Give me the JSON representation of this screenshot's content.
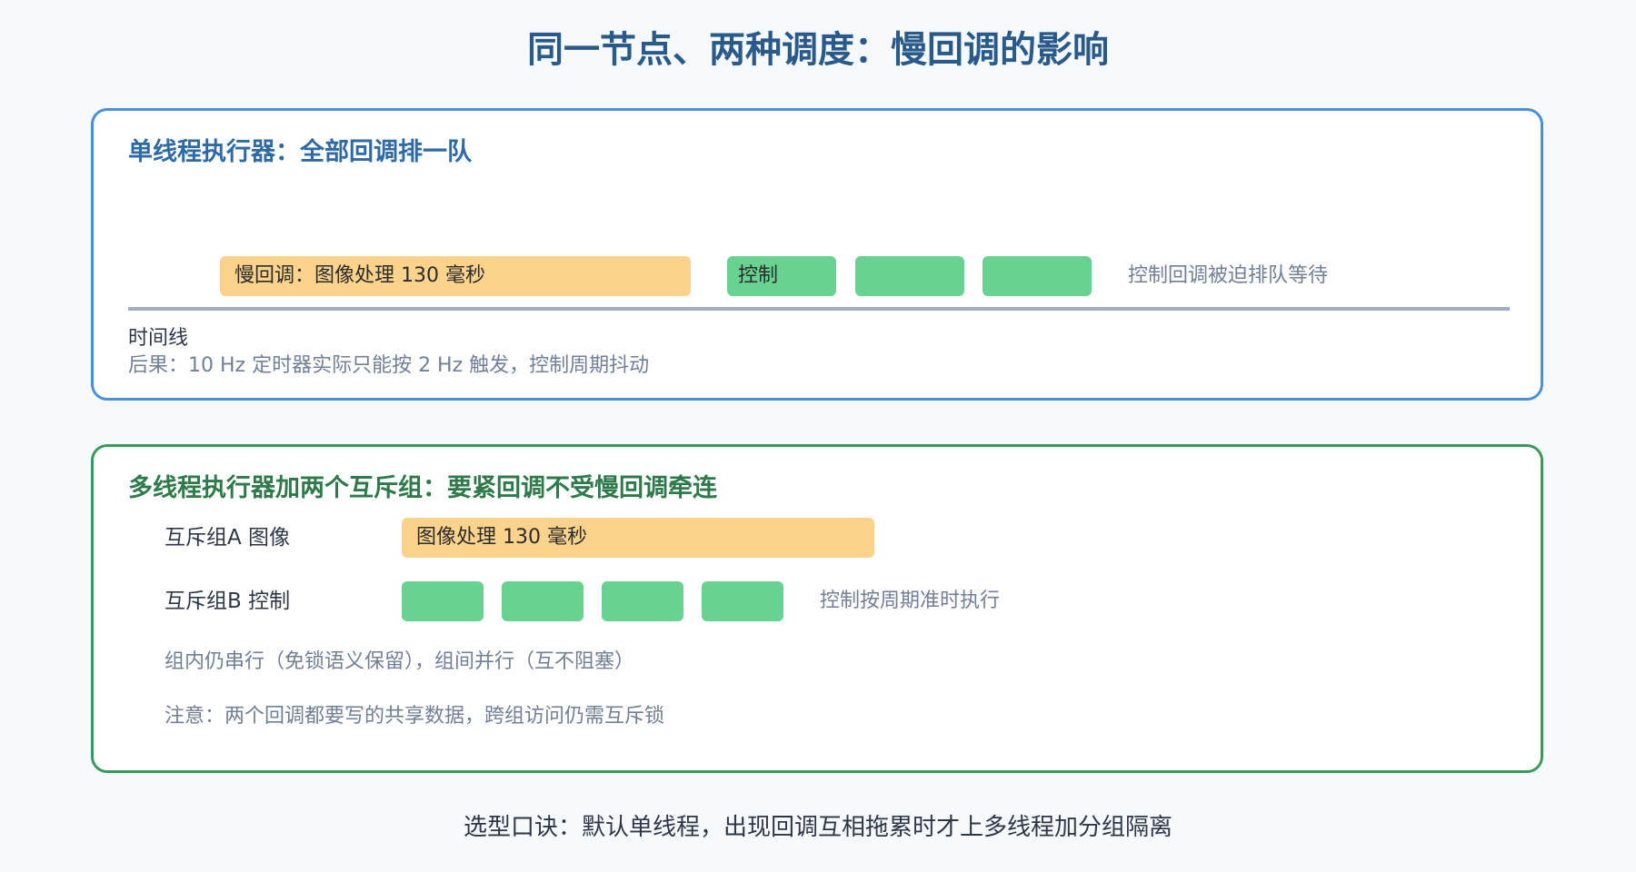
{
  "title": "同一节点、两种调度：慢回调的影响",
  "single_thread": {
    "heading": "单线程执行器：全部回调排一队",
    "slow_block": "慢回调：图像处理 130 毫秒",
    "control_label": "控制",
    "queued_note": "控制回调被迫排队等待",
    "timeline_label": "时间线",
    "consequence": "后果：10 Hz 定时器实际只能按 2 Hz 触发，控制周期抖动"
  },
  "multi_thread": {
    "heading": "多线程执行器加两个互斥组：要紧回调不受慢回调牵连",
    "group_a_label": "互斥组A 图像",
    "group_a_block": "图像处理 130 毫秒",
    "group_b_label": "互斥组B 控制",
    "group_b_note": "控制按周期准时执行",
    "rule_note": "组内仍串行（免锁语义保留），组间并行（互不阻塞）",
    "warning_note": "注意：两个回调都要写的共享数据，跨组访问仍需互斥锁"
  },
  "footer": "选型口诀：默认单线程，出现回调互相拖累时才上多线程加分组隔离",
  "colors": {
    "slow": "#fbd38d",
    "fast": "#68d391",
    "panel_top_border": "#4a90d9",
    "panel_bottom_border": "#3a9a5c"
  }
}
